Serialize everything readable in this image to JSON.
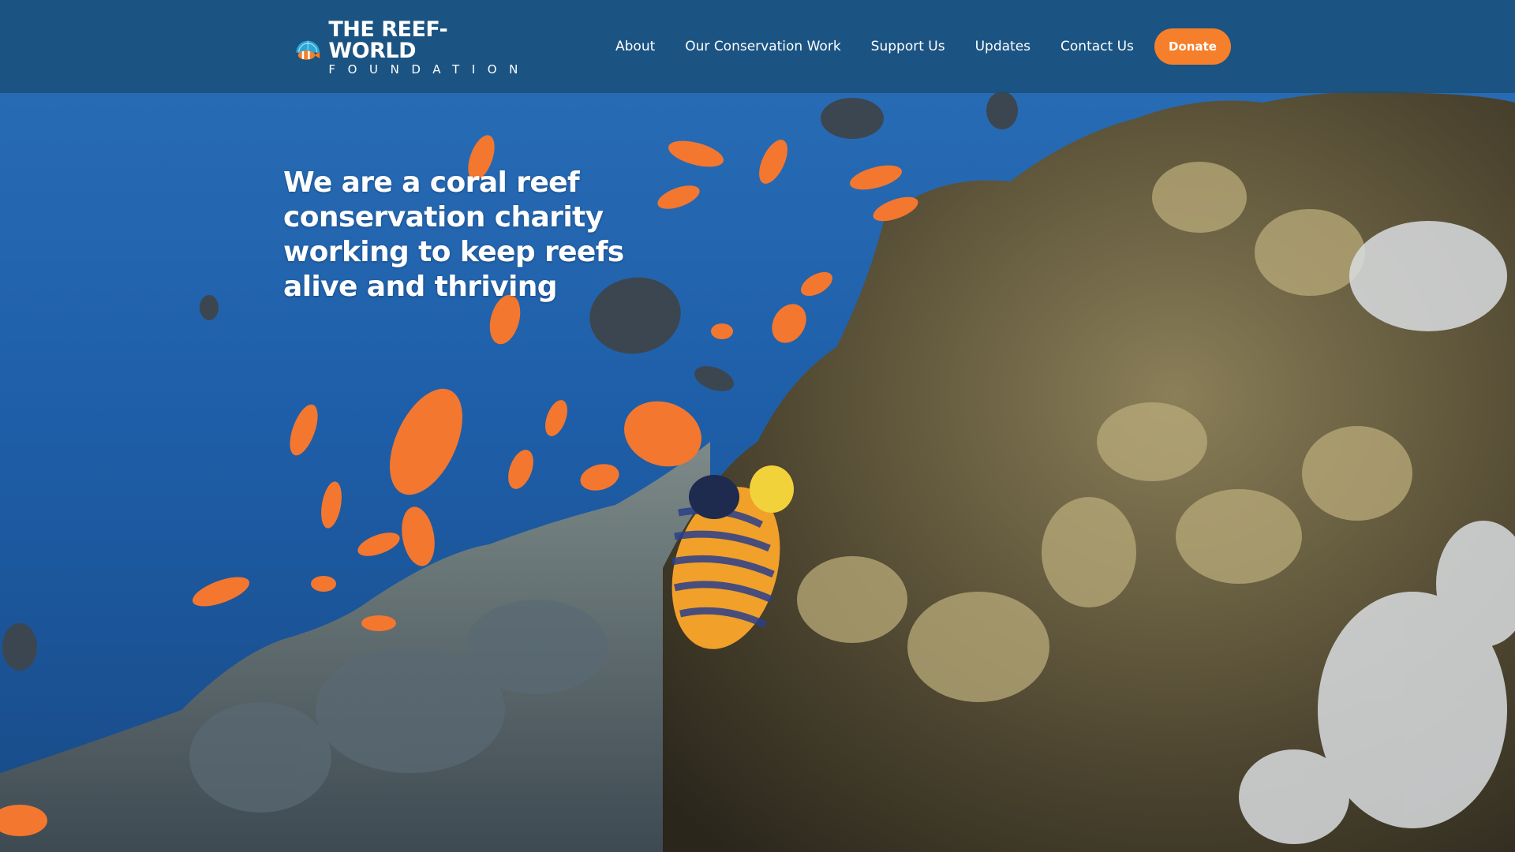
{
  "logo": {
    "title": "THE REEF-WORLD",
    "subtitle": "FOUNDATION",
    "icon": "clownfish-globe-icon"
  },
  "nav": {
    "items": [
      {
        "label": "About"
      },
      {
        "label": "Our Conservation Work"
      },
      {
        "label": "Support Us"
      },
      {
        "label": "Updates"
      },
      {
        "label": "Contact Us"
      }
    ],
    "donate_label": "Donate"
  },
  "hero": {
    "headline": "We are a coral reef conservation charity working to keep reefs alive and thriving",
    "background": "underwater-coral-reef-image"
  },
  "colors": {
    "accent": "#f57f2a",
    "nav_bg": "#184e76",
    "ocean": "#1a4f8f"
  }
}
